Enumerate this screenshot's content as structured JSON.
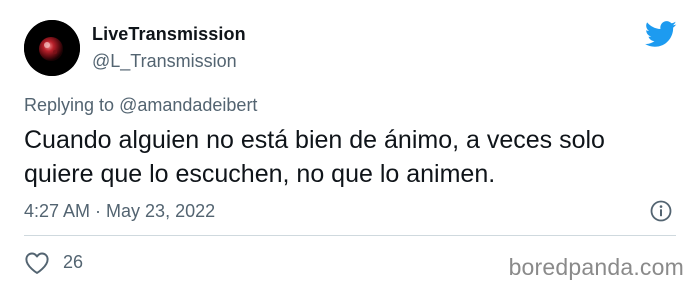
{
  "author": {
    "display_name": "LiveTransmission",
    "handle": "@L_Transmission",
    "avatar": "dark-red-planet-avatar"
  },
  "icons": {
    "platform": "twitter-bird-icon",
    "info": "info-circle-icon",
    "like": "heart-outline-icon"
  },
  "colors": {
    "twitter_blue": "#1d9bf0",
    "text_primary": "#0f1419",
    "text_secondary": "#536471"
  },
  "reply": {
    "prefix": "Replying to",
    "mention": "@amandadeibert"
  },
  "tweet": {
    "lines": [
      "Cuando alguien no está bien de ánimo, a veces solo",
      "quiere que lo escuchen, no que lo animen."
    ],
    "timestamp": "4:27 AM · May 23, 2022"
  },
  "engagement": {
    "likes": "26"
  },
  "watermark": "boredpanda.com"
}
